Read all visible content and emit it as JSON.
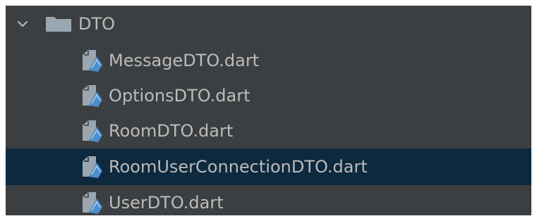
{
  "tree": {
    "folder": {
      "name": "DTO",
      "expanded": true,
      "toggle_icon": "chevron-down-icon",
      "icon": "folder-icon"
    },
    "files": [
      {
        "name": "MessageDTO.dart",
        "icon": "dart-file-icon",
        "selected": false
      },
      {
        "name": "OptionsDTO.dart",
        "icon": "dart-file-icon",
        "selected": false
      },
      {
        "name": "RoomDTO.dart",
        "icon": "dart-file-icon",
        "selected": false
      },
      {
        "name": "RoomUserConnectionDTO.dart",
        "icon": "dart-file-icon",
        "selected": true
      },
      {
        "name": "UserDTO.dart",
        "icon": "dart-file-icon",
        "selected": false
      }
    ]
  },
  "colors": {
    "panel_background": "#3c3f41",
    "selection_background": "#0d293e",
    "text": "#bbbbbb",
    "folder_icon": "#9aa7b0",
    "dart_icon_accent": "#4c8dcb"
  }
}
